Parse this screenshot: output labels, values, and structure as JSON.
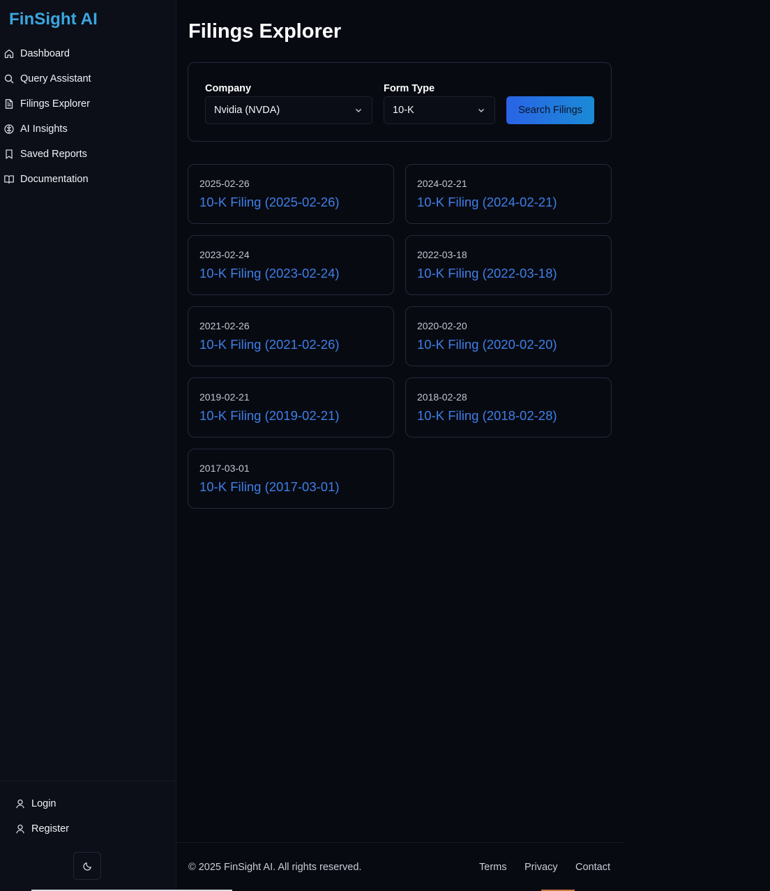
{
  "brand": "FinSight AI",
  "nav": [
    {
      "label": "Dashboard",
      "icon": "home-icon"
    },
    {
      "label": "Query Assistant",
      "icon": "search-icon"
    },
    {
      "label": "Filings Explorer",
      "icon": "document-icon"
    },
    {
      "label": "AI Insights",
      "icon": "brain-icon"
    },
    {
      "label": "Saved Reports",
      "icon": "bookmark-icon"
    },
    {
      "label": "Documentation",
      "icon": "book-icon"
    }
  ],
  "account": {
    "login": "Login",
    "register": "Register",
    "theme_icon": "moon-icon"
  },
  "page": {
    "title": "Filings Explorer"
  },
  "filters": {
    "company_label": "Company",
    "company_value": "Nvidia (NVDA)",
    "form_label": "Form Type",
    "form_value": "10-K",
    "search_button": "Search Filings"
  },
  "filings": [
    {
      "date": "2025-02-26",
      "title": "10-K Filing (2025-02-26)"
    },
    {
      "date": "2024-02-21",
      "title": "10-K Filing (2024-02-21)"
    },
    {
      "date": "2023-02-24",
      "title": "10-K Filing (2023-02-24)"
    },
    {
      "date": "2022-03-18",
      "title": "10-K Filing (2022-03-18)"
    },
    {
      "date": "2021-02-26",
      "title": "10-K Filing (2021-02-26)"
    },
    {
      "date": "2020-02-20",
      "title": "10-K Filing (2020-02-20)"
    },
    {
      "date": "2019-02-21",
      "title": "10-K Filing (2019-02-21)"
    },
    {
      "date": "2018-02-28",
      "title": "10-K Filing (2018-02-28)"
    },
    {
      "date": "2017-03-01",
      "title": "10-K Filing (2017-03-01)"
    }
  ],
  "footer": {
    "copyright": "© 2025 FinSight AI. All rights reserved.",
    "terms": "Terms",
    "privacy": "Privacy",
    "contact": "Contact"
  },
  "colors": {
    "accent": "#3f7fe6",
    "brand": "#3aa7e0",
    "background": "#080a12"
  }
}
